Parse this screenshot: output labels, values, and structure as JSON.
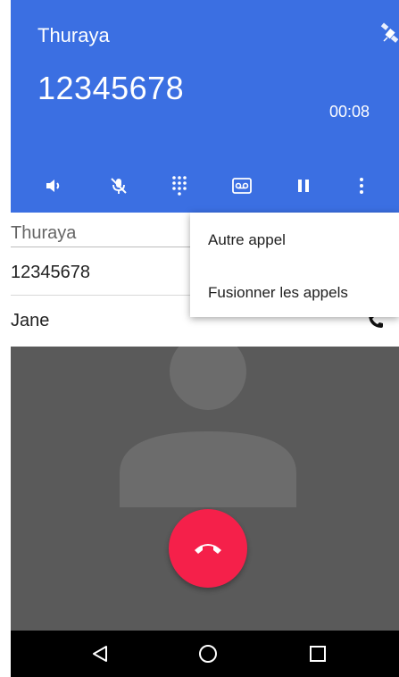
{
  "header": {
    "carrier": "Thuraya",
    "number": "12345678",
    "timer": "00:08",
    "background_color": "#3b6fe2",
    "satellite_icon": "satellite-icon"
  },
  "controls": [
    {
      "name": "speaker",
      "icon": "speaker-icon"
    },
    {
      "name": "mute",
      "icon": "mic-off-icon"
    },
    {
      "name": "dialpad",
      "icon": "dialpad-icon"
    },
    {
      "name": "voicemail",
      "icon": "voicemail-icon"
    },
    {
      "name": "hold",
      "icon": "pause-icon"
    },
    {
      "name": "more",
      "icon": "more-vert-icon"
    }
  ],
  "contacts": {
    "header": "Thuraya",
    "number": "12345678",
    "name": "Jane",
    "call_icon": "phone-icon"
  },
  "menu": {
    "items": [
      {
        "label": "Autre appel"
      },
      {
        "label": "Fusionner les appels"
      }
    ]
  },
  "end_call": {
    "icon": "call-end-icon",
    "color": "#f5204a"
  },
  "navbar": {
    "back": "back-icon",
    "home": "home-icon",
    "recents": "recents-icon"
  }
}
